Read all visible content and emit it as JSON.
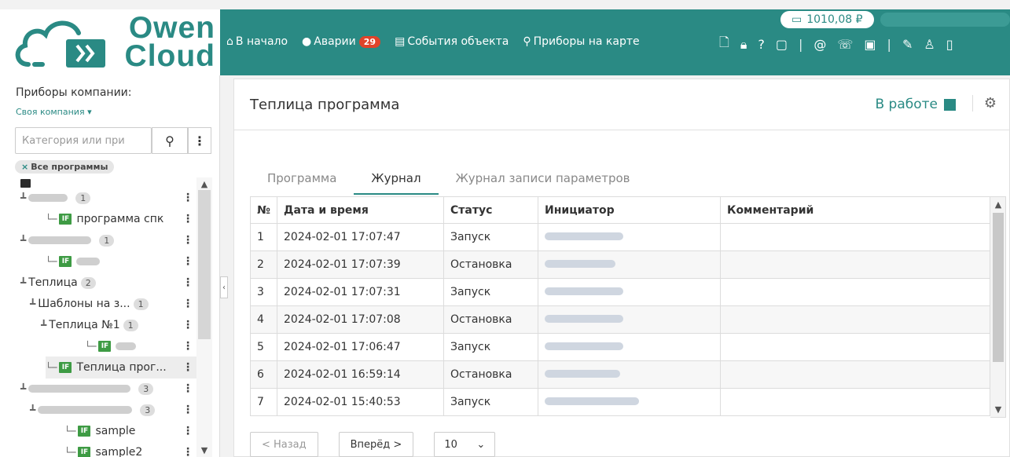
{
  "logo": {
    "line1": "Owen",
    "line2": "Cloud"
  },
  "header": {
    "balance": "1010,08 ₽",
    "nav": [
      {
        "icon": "home-icon",
        "glyph": "⌂",
        "label": "В начало"
      },
      {
        "icon": "alert-icon",
        "glyph": "●",
        "label": "Аварии",
        "badge": "29"
      },
      {
        "icon": "events-icon",
        "glyph": "▤",
        "label": "События объекта"
      },
      {
        "icon": "map-pin-icon",
        "glyph": "⚲",
        "label": "Приборы на карте"
      }
    ]
  },
  "sidebar": {
    "title": "Приборы компании:",
    "company": "Своя компания ▾",
    "search_placeholder": "Категория или при",
    "filter": "Все программы",
    "tree": [
      {
        "text": "",
        "count": "1"
      },
      {
        "text": "программа спк"
      },
      {
        "text": "",
        "count": "1"
      },
      {
        "text": ""
      },
      {
        "text": "Теплица",
        "count": "2"
      },
      {
        "text": "Шаблоны на з...",
        "count": "1"
      },
      {
        "text": "Теплица №1",
        "count": "1"
      },
      {
        "text": ""
      },
      {
        "text": "Теплица прог..."
      },
      {
        "text": "",
        "count": "3"
      },
      {
        "text": "",
        "count": "3"
      },
      {
        "text": "sample"
      },
      {
        "text": "sample2"
      }
    ]
  },
  "main": {
    "title": "Теплица программа",
    "status": "В работе",
    "tabs": [
      "Программа",
      "Журнал",
      "Журнал записи параметров"
    ],
    "active_tab": "Журнал",
    "columns": [
      "№",
      "Дата и время",
      "Статус",
      "Инициатор",
      "Комментарий"
    ],
    "rows": [
      {
        "n": "1",
        "dt": "2024-02-01 17:07:47",
        "status": "Запуск",
        "comment": ""
      },
      {
        "n": "2",
        "dt": "2024-02-01 17:07:39",
        "status": "Остановка",
        "comment": ""
      },
      {
        "n": "3",
        "dt": "2024-02-01 17:07:31",
        "status": "Запуск",
        "comment": ""
      },
      {
        "n": "4",
        "dt": "2024-02-01 17:07:08",
        "status": "Остановка",
        "comment": ""
      },
      {
        "n": "5",
        "dt": "2024-02-01 17:06:47",
        "status": "Запуск",
        "comment": ""
      },
      {
        "n": "6",
        "dt": "2024-02-01 16:59:14",
        "status": "Остановка",
        "comment": ""
      },
      {
        "n": "7",
        "dt": "2024-02-01 15:40:53",
        "status": "Запуск",
        "comment": ""
      }
    ],
    "pager": {
      "prev": "< Назад",
      "next": "Вперёд >",
      "page_size": "10"
    }
  },
  "colors": {
    "accent": "#2a8a84",
    "alert": "#e0432a",
    "program_icon": "#3e9b44"
  }
}
